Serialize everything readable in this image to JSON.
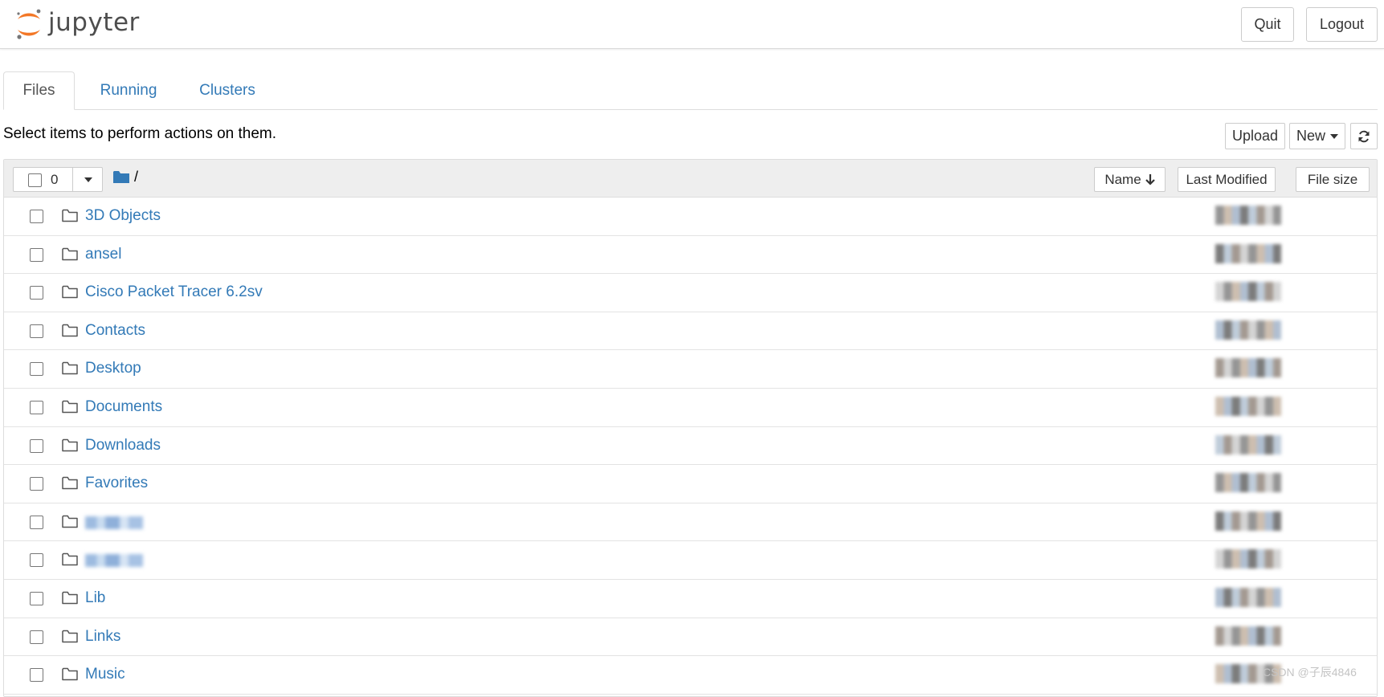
{
  "header": {
    "logo_text": "jupyter",
    "quit_label": "Quit",
    "logout_label": "Logout"
  },
  "tabs": [
    {
      "label": "Files",
      "active": true
    },
    {
      "label": "Running",
      "active": false
    },
    {
      "label": "Clusters",
      "active": false
    }
  ],
  "toolbar": {
    "instructions": "Select items to perform actions on them.",
    "upload_label": "Upload",
    "new_label": "New"
  },
  "list_header": {
    "selected_count": "0",
    "root_path": "/",
    "sort_name_label": "Name",
    "sort_modified_label": "Last Modified",
    "sort_size_label": "File size"
  },
  "files": [
    {
      "name": "3D Objects",
      "blurred": false
    },
    {
      "name": "ansel",
      "blurred": false
    },
    {
      "name": "Cisco Packet Tracer 6.2sv",
      "blurred": false
    },
    {
      "name": "Contacts",
      "blurred": false
    },
    {
      "name": "Desktop",
      "blurred": false
    },
    {
      "name": "Documents",
      "blurred": false
    },
    {
      "name": "Downloads",
      "blurred": false
    },
    {
      "name": "Favorites",
      "blurred": false
    },
    {
      "name": "",
      "blurred": true
    },
    {
      "name": "",
      "blurred": true
    },
    {
      "name": "Lib",
      "blurred": false
    },
    {
      "name": "Links",
      "blurred": false
    },
    {
      "name": "Music",
      "blurred": false
    }
  ],
  "watermark": "CSDN @子辰4846",
  "colors": {
    "link": "#337ab7",
    "logo_orange": "#f37726",
    "header_bg": "#eeeeee"
  }
}
